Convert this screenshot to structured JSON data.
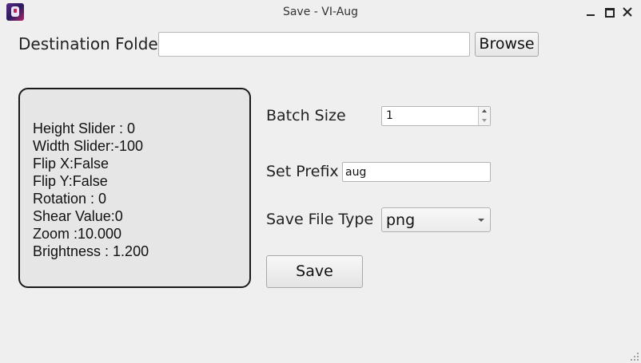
{
  "window": {
    "title": "Save - VI-Aug",
    "icon": "app-icon",
    "controls": [
      "minimize-icon",
      "maximize-icon",
      "close-icon"
    ]
  },
  "destination": {
    "label": "Destination Folder",
    "value": "",
    "browse_label": "Browse"
  },
  "info": {
    "lines": [
      "Height Slider : 0",
      "Width Slider:-100",
      "Flip X:False",
      "Flip Y:False",
      "Rotation : 0",
      "Shear Value:0",
      "Zoom :10.000",
      "Brightness : 1.200"
    ]
  },
  "form": {
    "batch_label": "Batch Size",
    "batch_value": "1",
    "prefix_label": "Set Prefix",
    "prefix_value": "aug",
    "type_label": "Save File Type",
    "type_value": "png",
    "save_label": "Save"
  }
}
